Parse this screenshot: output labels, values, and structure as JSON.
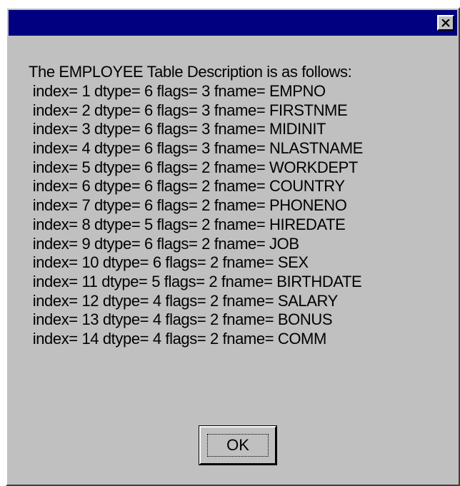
{
  "dialog": {
    "title": "",
    "close_icon": "close-icon",
    "message": {
      "header": "The EMPLOYEE Table Description is as follows:",
      "lines": [
        " index= 1 dtype= 6 flags= 3 fname= EMPNO",
        " index= 2 dtype= 6 flags= 3 fname= FIRSTNME",
        " index= 3 dtype= 6 flags= 3 fname= MIDINIT",
        " index= 4 dtype= 6 flags= 3 fname= NLASTNAME",
        " index= 5 dtype= 6 flags= 2 fname= WORKDEPT",
        " index= 6 dtype= 6 flags= 2 fname= COUNTRY",
        " index= 7 dtype= 6 flags= 2 fname= PHONENO",
        " index= 8 dtype= 5 flags= 2 fname= HIREDATE",
        " index= 9 dtype= 6 flags= 2 fname= JOB",
        " index= 10 dtype= 6 flags= 2 fname= SEX",
        " index= 11 dtype= 5 flags= 2 fname= BIRTHDATE",
        " index= 12 dtype= 4 flags= 2 fname= SALARY",
        " index= 13 dtype= 4 flags= 2 fname= BONUS",
        " index= 14 dtype= 4 flags= 2 fname= COMM"
      ]
    },
    "ok_label": "OK"
  },
  "colors": {
    "titlebar": "#000080",
    "dialog_bg": "#c0c0c0"
  }
}
